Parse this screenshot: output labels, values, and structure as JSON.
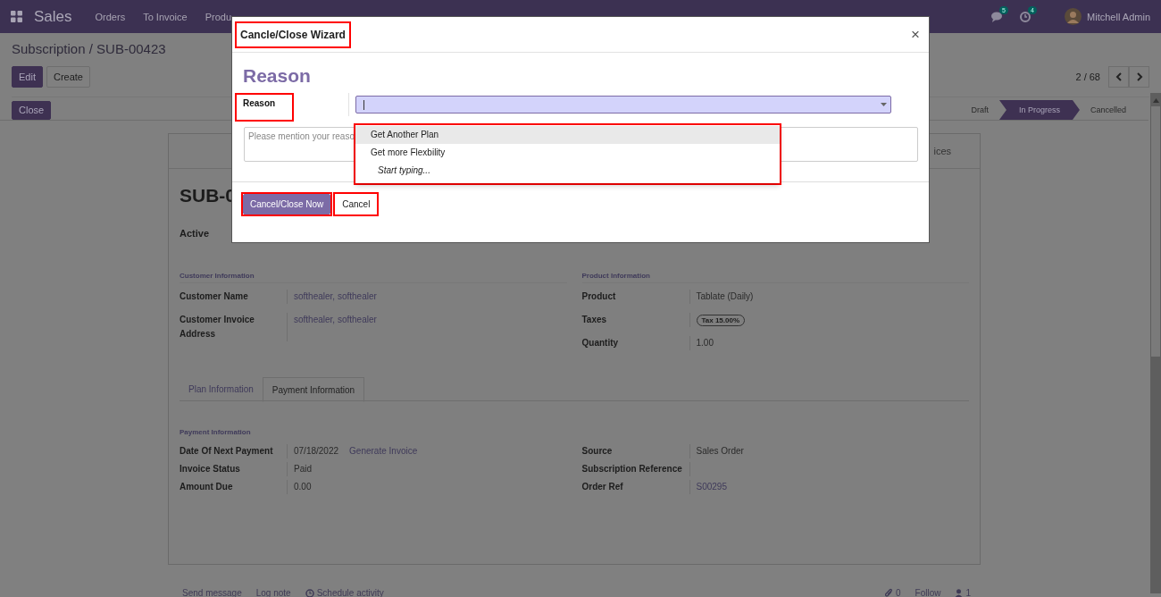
{
  "navbar": {
    "app": "Sales",
    "menu": [
      "Orders",
      "To Invoice",
      "Produ"
    ],
    "messages_badge": "5",
    "activities_badge": "4",
    "user": "Mitchell Admin"
  },
  "breadcrumb": "Subscription / SUB-00423",
  "actions": [
    {
      "label": "Edit",
      "kind": "primary"
    },
    {
      "label": "Create",
      "kind": "secondary"
    }
  ],
  "pager": "2 / 68",
  "close_button": "Close",
  "statusbar": [
    {
      "label": "Draft",
      "selected": false
    },
    {
      "label": "In Progress",
      "selected": true
    },
    {
      "label": "Cancelled",
      "selected": false
    }
  ],
  "form": {
    "smart_button": "ices",
    "title": "SUB-0",
    "active_label": "Active",
    "top_groups": [
      {
        "heading": "Customer Information",
        "fields": [
          {
            "label": "Customer Name",
            "kind": "link",
            "value": "softhealer, softhealer"
          },
          {
            "label": "Customer Invoice Address",
            "kind": "link",
            "value": "softhealer, softhealer"
          }
        ]
      },
      {
        "heading": "Product Information",
        "fields": [
          {
            "label": "Product",
            "kind": "text",
            "value": "Tablate (Daily)"
          },
          {
            "label": "Taxes",
            "kind": "tag",
            "value": "Tax 15.00%"
          },
          {
            "label": "Quantity",
            "kind": "text",
            "value": "1.00"
          }
        ]
      }
    ],
    "tabs": [
      {
        "label": "Plan Information",
        "selected": false
      },
      {
        "label": "Payment Information",
        "selected": true
      }
    ],
    "tab_heading": "Payment Information",
    "tab_groups": [
      {
        "fields": [
          {
            "label": "Date Of Next Payment",
            "kind": "text",
            "value": "07/18/2022",
            "action": "Generate Invoice"
          },
          {
            "label": "Invoice Status",
            "kind": "text",
            "value": "Paid"
          },
          {
            "label": "Amount Due",
            "kind": "text",
            "value": "0.00"
          }
        ]
      },
      {
        "fields": [
          {
            "label": "Source",
            "kind": "text",
            "value": "Sales Order"
          },
          {
            "label": "Subscription Reference",
            "kind": "text"
          },
          {
            "label": "Order Ref",
            "kind": "link",
            "value": "S00295"
          }
        ]
      }
    ]
  },
  "chatter": {
    "send": "Send message",
    "log": "Log note",
    "schedule": "Schedule activity",
    "attachments": "0",
    "follow": "Follow",
    "followers": "1"
  },
  "dialog": {
    "title": "Cancle/Close Wizard",
    "title_highlighted": true,
    "close": "×",
    "heading": "Reason",
    "field_label": "Reason",
    "label_highlighted": true,
    "placeholder": "Please mention your reaso",
    "options": [
      {
        "label": "Get Another Plan",
        "selected": true
      },
      {
        "label": "Get more Flexbility",
        "selected": false
      }
    ],
    "dropdown_hint": "Start typing...",
    "dropdown_highlighted": true,
    "buttons": [
      {
        "label": "Cancel/Close Now",
        "kind": "primary",
        "highlighted": true
      },
      {
        "label": "Cancel",
        "kind": "secondary",
        "highlighted": true
      }
    ]
  }
}
